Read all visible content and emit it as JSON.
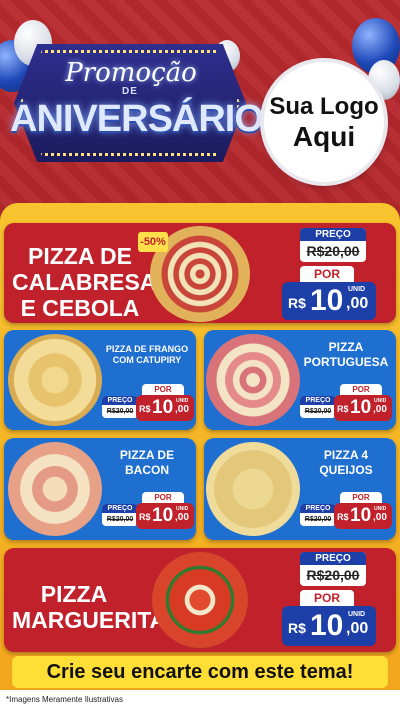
{
  "header": {
    "title_line1": "Promoção",
    "title_line2": "DE",
    "title_line3": "ANIVERSÁRIO",
    "logo_line1": "Sua Logo",
    "logo_line2": "Aqui"
  },
  "featured": [
    {
      "name_line1": "PIZZA DE",
      "name_line2": "CALABRESA",
      "name_line3": "E CEBOLA",
      "discount": "-50%",
      "preco_label": "PREÇO",
      "old_price": "R$20,00",
      "por_label": "POR",
      "currency": "R$",
      "price_int": "10",
      "price_dec": ",00",
      "unit": "UNID"
    },
    {
      "name_line1": "PIZZA",
      "name_line2": "MARGUERITA",
      "preco_label": "PREÇO",
      "old_price": "R$20,00",
      "por_label": "POR",
      "currency": "R$",
      "price_int": "10",
      "price_dec": ",00",
      "unit": "UNID"
    }
  ],
  "items": [
    {
      "name_line1": "PIZZA DE FRANGO",
      "name_line2": "COM CATUPIRY",
      "preco_label": "PREÇO",
      "old_price": "R$20,00",
      "por_label": "POR",
      "currency": "R$",
      "price_int": "10",
      "price_dec": ",00",
      "unit": "UNID"
    },
    {
      "name_line1": "PIZZA",
      "name_line2": "PORTUGUESA",
      "preco_label": "PREÇO",
      "old_price": "R$20,00",
      "por_label": "POR",
      "currency": "R$",
      "price_int": "10",
      "price_dec": ",00",
      "unit": "UNID"
    },
    {
      "name_line1": "PIZZA DE",
      "name_line2": "BACON",
      "preco_label": "PREÇO",
      "old_price": "R$20,00",
      "por_label": "POR",
      "currency": "R$",
      "price_int": "10",
      "price_dec": ",00",
      "unit": "UNID"
    },
    {
      "name_line1": "PIZZA 4",
      "name_line2": "QUEIJOS",
      "preco_label": "PREÇO",
      "old_price": "R$20,00",
      "por_label": "POR",
      "currency": "R$",
      "price_int": "10",
      "price_dec": ",00",
      "unit": "UNID"
    }
  ],
  "cta": "Crie seu encarte com este tema!",
  "footer_note": "*Imagens Meramente Ilustrativas",
  "colors": {
    "red": "#c0212b",
    "blue": "#1f6fd1",
    "navy": "#1c3fa8",
    "yellow": "#f7c52f"
  }
}
